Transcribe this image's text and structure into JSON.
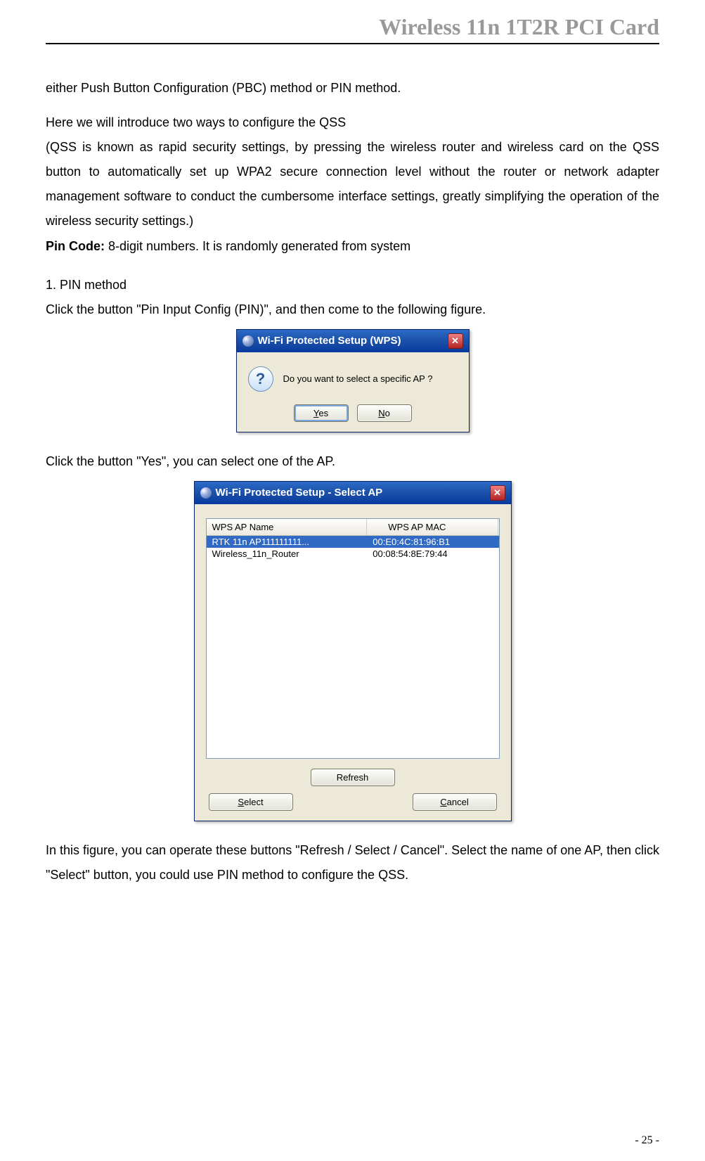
{
  "header": {
    "title": "Wireless 11n 1T2R PCI Card"
  },
  "paragraphs": {
    "p1": "either Push Button Configuration (PBC) method or PIN method.",
    "p2a": "Here we will introduce two ways to configure the QSS",
    "p2b": "(QSS is known as rapid security settings, by pressing the wireless router and wireless card on the QSS button to automatically set up WPA2 secure connection level without the router or network adapter management software to conduct the cumbersome interface settings, greatly simplifying the operation of the wireless security settings.)",
    "pin_label": "Pin Code: ",
    "pin_text": "8-digit numbers. It is randomly generated from system",
    "step1_num": "1.   PIN method",
    "step1_text": "Click the button \"Pin Input Config (PIN)\", and then come to the following figure.",
    "click_yes": "Click the button \"Yes\", you can select one of the AP.",
    "final": "In this figure, you can operate these buttons \"Refresh / Select / Cancel\". Select the name of one AP, then click \"Select\" button, you could use PIN method to configure the QSS."
  },
  "dialog1": {
    "title": "Wi-Fi Protected Setup (WPS)",
    "question": "Do you want to select a specific AP ?",
    "yes": "Yes",
    "no": "No"
  },
  "dialog2": {
    "title": "Wi-Fi Protected Setup - Select AP",
    "col_name": "WPS AP Name",
    "col_mac": "WPS AP MAC",
    "rows": [
      {
        "name": "RTK 11n AP111111111...",
        "mac": "00:E0:4C:81:96:B1"
      },
      {
        "name": "Wireless_11n_Router",
        "mac": "00:08:54:8E:79:44"
      }
    ],
    "refresh": "Refresh",
    "select": "Select",
    "cancel": "Cancel"
  },
  "footer": {
    "page_number": "- 25 -"
  }
}
